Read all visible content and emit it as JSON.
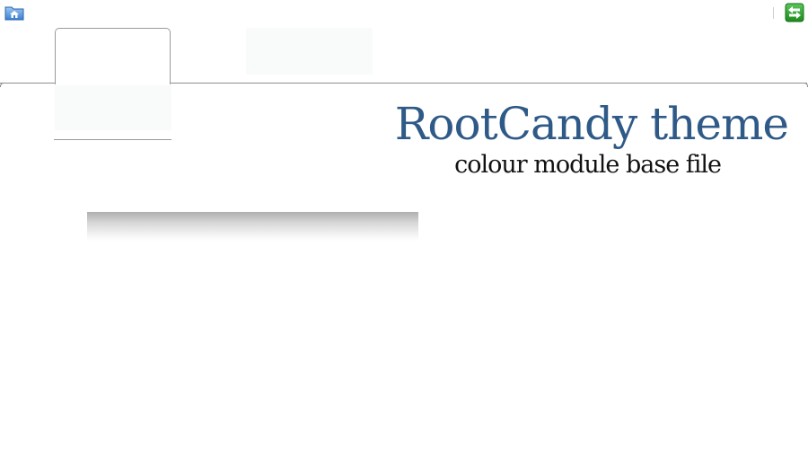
{
  "header": {
    "home_icon": "home-folder-icon",
    "logout_icon": "logout-arrows-icon"
  },
  "tabs": [
    {
      "label": "",
      "active": true
    },
    {
      "label": "",
      "active": false
    }
  ],
  "title": {
    "main": "RootCandy theme",
    "sub": "colour module base file"
  },
  "colors": {
    "title": "#2f5a87",
    "subtitle": "#111111",
    "tab_border": "#9a9a9a",
    "tab_inactive_bg": "#f9fafa",
    "logout_green": "#2e9e2e",
    "home_blue": "#4a90d9"
  }
}
